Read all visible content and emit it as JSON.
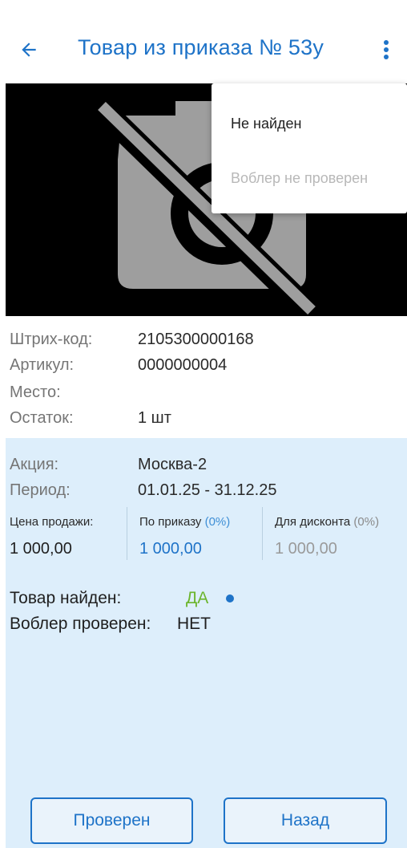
{
  "header": {
    "title": "Товар из приказа № 53у",
    "back_icon": "arrow-left-icon",
    "more_icon": "more-vert-icon",
    "accent_color": "#1e73c8"
  },
  "photo": {
    "icon": "no-photo-icon"
  },
  "menu": {
    "items": [
      {
        "label": "Не найден",
        "enabled": true
      },
      {
        "label": "Воблер не проверен",
        "enabled": false
      }
    ]
  },
  "product": {
    "barcode_label": "Штрих-код:",
    "barcode_value": "2105300000168",
    "article_label": "Артикул:",
    "article_value": "0000000004",
    "place_label": "Место:",
    "place_value": "",
    "stock_label": "Остаток:",
    "stock_value": "1 шт"
  },
  "promo": {
    "action_label": "Акция:",
    "action_value": "Москва-2",
    "period_label": "Период:",
    "period_value": "01.01.25 - 31.12.25",
    "prices": [
      {
        "caption": "Цена продажи:",
        "percent": "",
        "value": "1 000,00"
      },
      {
        "caption": "По приказу",
        "percent": "(0%)",
        "value": "1 000,00"
      },
      {
        "caption": "Для дисконта",
        "percent": "(0%)",
        "value": "1 000,00"
      }
    ]
  },
  "status": {
    "found_label": "Товар найден:",
    "found_value": "ДА",
    "found_color": "#6cb52d",
    "dot_color": "#1e73c8",
    "wobbler_label": "Воблер проверен:",
    "wobbler_value": "НЕТ"
  },
  "buttons": {
    "checked_label": "Проверен",
    "back_label": "Назад"
  }
}
